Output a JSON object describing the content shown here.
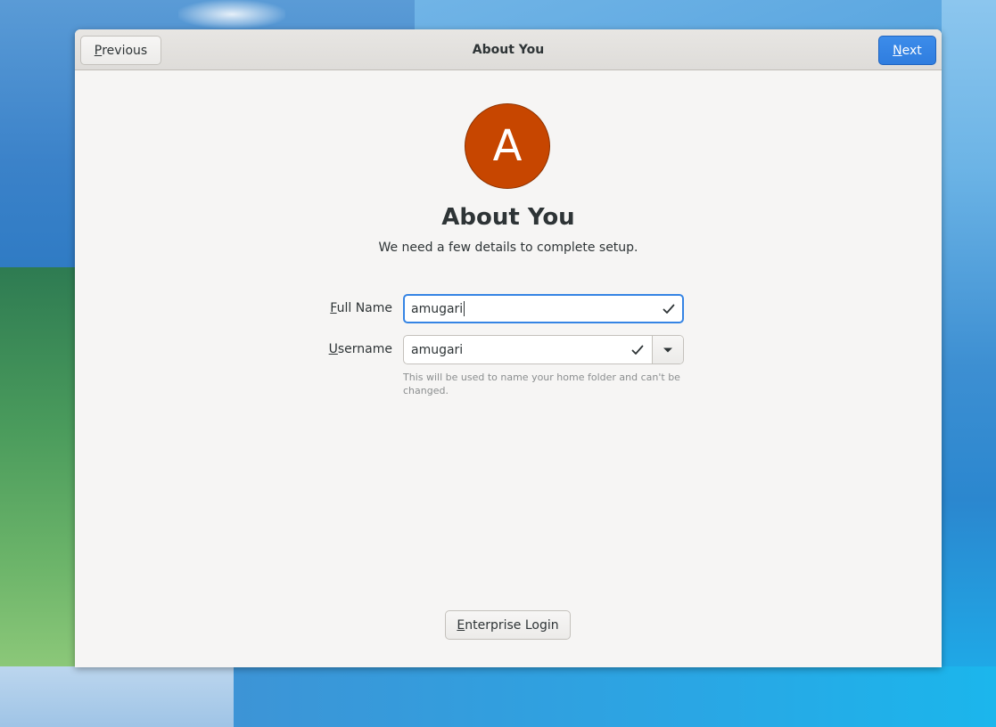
{
  "window": {
    "title": "About You"
  },
  "headerbar": {
    "previous_label": "Previous",
    "previous_mnemonic": "P",
    "previous_rest": "revious",
    "next_label": "Next",
    "next_mnemonic": "N",
    "next_rest": "ext"
  },
  "avatar": {
    "initial": "A",
    "color": "#c74600"
  },
  "page": {
    "title": "About You",
    "subtitle": "We need a few details to complete setup."
  },
  "form": {
    "full_name": {
      "label": "Full Name",
      "label_mnemonic": "F",
      "label_rest": "ull Name",
      "value": "amugari",
      "valid": true,
      "focused": true
    },
    "username": {
      "label": "Username",
      "label_mnemonic": "U",
      "label_rest": "sername",
      "value": "amugari",
      "valid": true,
      "hint": "This will be used to name your home folder and can't be changed."
    }
  },
  "footer": {
    "enterprise_label": "Enterprise Login",
    "enterprise_mnemonic": "E",
    "enterprise_rest": "nterprise Login"
  },
  "icons": {
    "check": "check-icon",
    "dropdown": "chevron-down-icon"
  },
  "colors": {
    "accent": "#3584e4",
    "window_bg": "#f6f5f4",
    "text": "#2e3436"
  }
}
